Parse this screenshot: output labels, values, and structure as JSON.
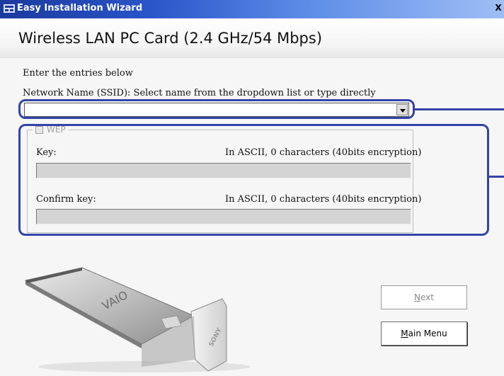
{
  "window": {
    "title": "Easy Installation Wizard",
    "close_glyph": "X"
  },
  "header": {
    "title": "Wireless LAN PC Card (2.4 GHz/54 Mbps)"
  },
  "form": {
    "instruction": "Enter the entries below",
    "ssid_label": "Network Name (SSID): Select name from the dropdown list or type directly",
    "ssid_value": "",
    "wep": {
      "legend": "WEP",
      "checked": false,
      "key_label": "Key:",
      "key_info": "In ASCII, 0 characters (40bits encryption)",
      "key_value": "",
      "confirm_label": "Confirm key:",
      "confirm_info": "In ASCII, 0 characters (40bits encryption)",
      "confirm_value": ""
    }
  },
  "buttons": {
    "next": {
      "mnemonic": "N",
      "rest": "ext",
      "enabled": false
    },
    "main_menu": {
      "mnemonic": "M",
      "rest": "ain Menu",
      "enabled": true
    }
  },
  "illustration": {
    "brand_text_1": "VAIO",
    "brand_text_2": "SONY",
    "icon": "pc-card-illustration"
  },
  "colors": {
    "callout": "#3344a8",
    "titlebar": "#2a55c9"
  }
}
